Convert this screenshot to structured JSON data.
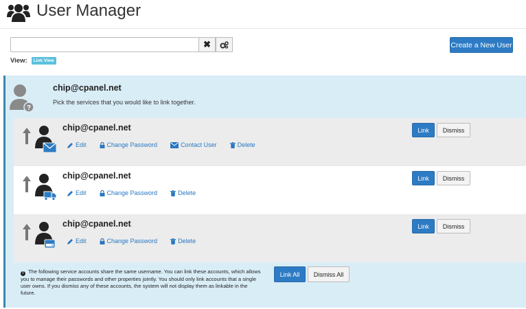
{
  "header": {
    "title": "User Manager",
    "icon": "users-icon"
  },
  "toolbar": {
    "search_value": "",
    "search_placeholder": "",
    "clear_glyph": "✖",
    "create_label": "Create a New User",
    "view_label": "View:",
    "view_badge": "Link View"
  },
  "panel": {
    "email": "chip@cpanel.net",
    "instruction": "Pick the services that you would like to link together."
  },
  "rows": [
    {
      "email": "chip@cpanel.net",
      "service": "email",
      "actions": {
        "edit": "Edit",
        "change_password": "Change Password",
        "contact": "Contact User",
        "delete": "Delete"
      },
      "link": "Link",
      "dismiss": "Dismiss"
    },
    {
      "email": "chip@cpanel.net",
      "service": "ftp",
      "actions": {
        "edit": "Edit",
        "change_password": "Change Password",
        "delete": "Delete"
      },
      "link": "Link",
      "dismiss": "Dismiss"
    },
    {
      "email": "chip@cpanel.net",
      "service": "web-disk",
      "actions": {
        "edit": "Edit",
        "change_password": "Change Password",
        "delete": "Delete"
      },
      "link": "Link",
      "dismiss": "Dismiss"
    }
  ],
  "footer": {
    "note_icon": "!",
    "note": "The following service accounts share the same username. You can link these accounts, which allows you to manage their passwords and other properties jointly. You should only link accounts that a single user owns. If you dismiss any of these accounts, the system will not display them as linkable in the future.",
    "link_all": "Link All",
    "dismiss_all": "Dismiss All"
  },
  "colors": {
    "primary": "#2d7bc4",
    "panel_bg": "#d9edf7",
    "panel_border": "#3a87ad",
    "link": "#2a78c2",
    "badge": "#5bc0de"
  }
}
